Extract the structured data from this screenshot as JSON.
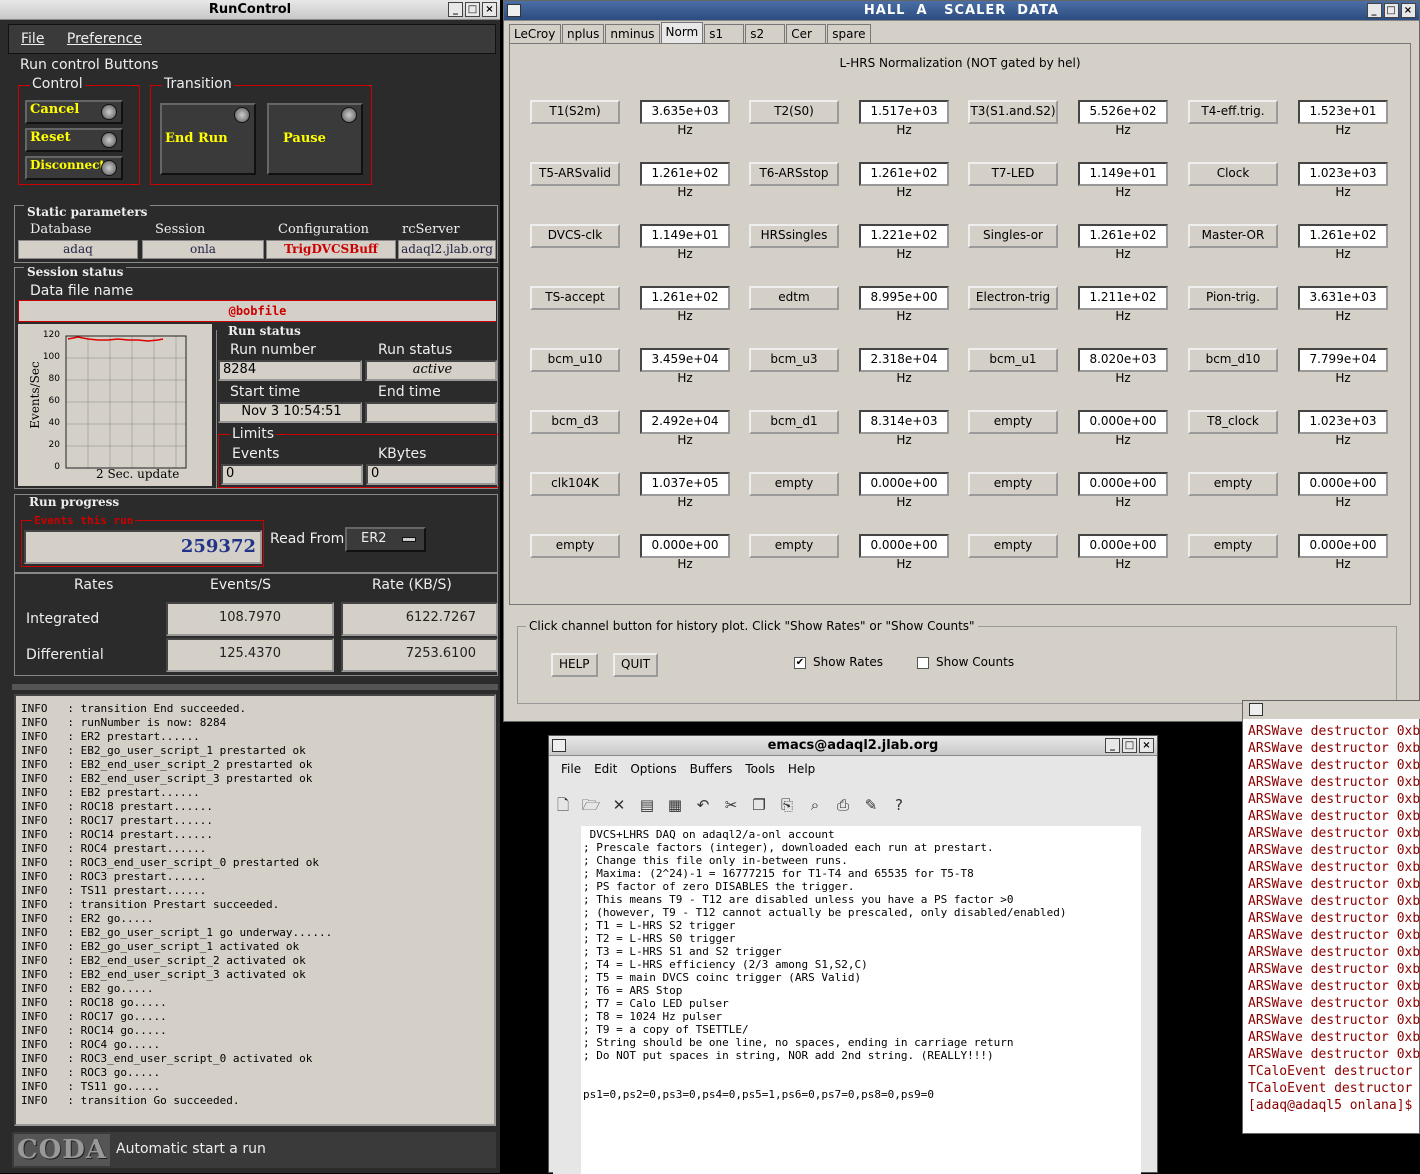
{
  "runcontrol": {
    "title": "RunControl",
    "menu": [
      "File",
      "Preference"
    ],
    "buttons_group": "Run control Buttons",
    "control_label": "Control",
    "cancel": "Cancel",
    "reset": "Reset",
    "disconnect": "Disconnect",
    "transition_label": "Transition",
    "end_run": "End Run",
    "pause": "Pause",
    "static_params": "Static parameters",
    "database_label": "Database",
    "database": "adaq",
    "session_label": "Session",
    "session": "onla",
    "config_label": "Configuration",
    "config": "TrigDVCSBuff",
    "rcserver_label": "rcServer",
    "rcserver": "adaql2.jlab.org",
    "session_status": "Session status",
    "datafile_label": "Data file name",
    "datafile": "@bobfile",
    "chart_ylabel": "Events/Sec",
    "chart_xlabel": "2 Sec. update",
    "chart_ticks": [
      "120",
      "100",
      "80",
      "60",
      "40",
      "20",
      "0"
    ],
    "run_status_title": "Run status",
    "run_number_label": "Run number",
    "run_number": "8284",
    "run_status_label": "Run status",
    "run_status": "active",
    "start_time_label": "Start time",
    "start_time": "Nov 3 10:54:51",
    "end_time_label": "End time",
    "end_time": "",
    "limits_label": "Limits",
    "events_label": "Events",
    "events_limit": "0",
    "kbytes_label": "KBytes",
    "kbytes_limit": "0",
    "run_progress": "Run progress",
    "events_this_run_label": "Events this run",
    "events_this_run": "259372",
    "read_from_label": "Read From:",
    "read_from": "ER2",
    "rates_header": "Rates",
    "events_s_header": "Events/S",
    "rate_kbs_header": "Rate (KB/S)",
    "integrated_label": "Integrated",
    "integrated_events": "108.7970",
    "integrated_rate": "6122.7267",
    "differential_label": "Differential",
    "differential_events": "125.4370",
    "differential_rate": "7253.6100",
    "log": "INFO   : transition End succeeded.\nINFO   : runNumber is now: 8284\nINFO   : ER2 prestart......\nINFO   : EB2_go_user_script_1 prestarted ok\nINFO   : EB2_end_user_script_2 prestarted ok\nINFO   : EB2_end_user_script_3 prestarted ok\nINFO   : EB2 prestart......\nINFO   : ROC18 prestart......\nINFO   : ROC17 prestart......\nINFO   : ROC14 prestart......\nINFO   : ROC4 prestart......\nINFO   : ROC3_end_user_script_0 prestarted ok\nINFO   : ROC3 prestart......\nINFO   : TS11 prestart......\nINFO   : transition Prestart succeeded.\nINFO   : ER2 go.....\nINFO   : EB2_go_user_script_1 go underway......\nINFO   : EB2_go_user_script_1 activated ok\nINFO   : EB2_end_user_script_2 activated ok\nINFO   : EB2_end_user_script_3 activated ok\nINFO   : EB2 go.....\nINFO   : ROC18 go.....\nINFO   : ROC17 go.....\nINFO   : ROC14 go.....\nINFO   : ROC4 go.....\nINFO   : ROC3_end_user_script_0 activated ok\nINFO   : ROC3 go.....\nINFO   : TS11 go.....\nINFO   : transition Go succeeded.",
    "coda_logo": "CODA",
    "status_msg": "Automatic start a run"
  },
  "scaler": {
    "title": "HALL  A   SCALER  DATA",
    "tabs": [
      "LeCroy",
      "nplus",
      "nminus",
      "Norm",
      "s1",
      "s2",
      "Cer",
      "spare"
    ],
    "active_tab": "Norm",
    "panel_title": "L-HRS Normalization (NOT gated by hel)",
    "rows": [
      [
        [
          "T1(S2m)",
          "3.635e+03 Hz"
        ],
        [
          "T2(S0)",
          "1.517e+03 Hz"
        ],
        [
          "T3(S1.and.S2)",
          "5.526e+02 Hz"
        ],
        [
          "T4-eff.trig.",
          "1.523e+01 Hz"
        ]
      ],
      [
        [
          "T5-ARSvalid",
          "1.261e+02 Hz"
        ],
        [
          "T6-ARSstop",
          "1.261e+02 Hz"
        ],
        [
          "T7-LED",
          "1.149e+01 Hz"
        ],
        [
          "Clock",
          "1.023e+03 Hz"
        ]
      ],
      [
        [
          "DVCS-clk",
          "1.149e+01 Hz"
        ],
        [
          "HRSsingles",
          "1.221e+02 Hz"
        ],
        [
          "Singles-or",
          "1.261e+02 Hz"
        ],
        [
          "Master-OR",
          "1.261e+02 Hz"
        ]
      ],
      [
        [
          "TS-accept",
          "1.261e+02 Hz"
        ],
        [
          "edtm",
          "8.995e+00 Hz"
        ],
        [
          "Electron-trig",
          "1.211e+02 Hz"
        ],
        [
          "Pion-trig.",
          "3.631e+03 Hz"
        ]
      ],
      [
        [
          "bcm_u10",
          "3.459e+04 Hz"
        ],
        [
          "bcm_u3",
          "2.318e+04 Hz"
        ],
        [
          "bcm_u1",
          "8.020e+03 Hz"
        ],
        [
          "bcm_d10",
          "7.799e+04 Hz"
        ]
      ],
      [
        [
          "bcm_d3",
          "2.492e+04 Hz"
        ],
        [
          "bcm_d1",
          "8.314e+03 Hz"
        ],
        [
          "empty",
          "0.000e+00 Hz"
        ],
        [
          "T8_clock",
          "1.023e+03 Hz"
        ]
      ],
      [
        [
          "clk104K",
          "1.037e+05 Hz"
        ],
        [
          "empty",
          "0.000e+00 Hz"
        ],
        [
          "empty",
          "0.000e+00 Hz"
        ],
        [
          "empty",
          "0.000e+00 Hz"
        ]
      ],
      [
        [
          "empty",
          "0.000e+00 Hz"
        ],
        [
          "empty",
          "0.000e+00 Hz"
        ],
        [
          "empty",
          "0.000e+00 Hz"
        ],
        [
          "empty",
          "0.000e+00 Hz"
        ]
      ]
    ],
    "hint": "Click channel button for history plot.  Click \"Show Rates\" or \"Show Counts\"",
    "help": "HELP",
    "quit": "QUIT",
    "show_rates": "Show Rates",
    "show_rates_checked": true,
    "show_counts": "Show Counts",
    "show_counts_checked": false
  },
  "emacs": {
    "title": "emacs@adaql2.jlab.org",
    "menu": [
      "File",
      "Edit",
      "Options",
      "Buffers",
      "Tools",
      "Help"
    ],
    "tools": [
      "new-file-icon",
      "open-folder-icon",
      "close-icon",
      "save-icon",
      "save-as-icon",
      "undo-icon",
      "cut-icon",
      "copy-icon",
      "paste-icon",
      "search-icon",
      "print-icon",
      "spell-icon",
      "help-icon"
    ],
    "text": " DVCS+LHRS DAQ on adaql2/a-onl account\n; Prescale factors (integer), downloaded each run at prestart.\n; Change this file only in-between runs.\n; Maxima: (2^24)-1 = 16777215 for T1-T4 and 65535 for T5-T8\n; PS factor of zero DISABLES the trigger.\n; This means T9 - T12 are disabled unless you have a PS factor >0\n; (however, T9 - T12 cannot actually be prescaled, only disabled/enabled)\n; T1 = L-HRS S2 trigger\n; T2 = L-HRS S0 trigger\n; T3 = L-HRS S1 and S2 trigger\n; T4 = L-HRS efficiency (2/3 among S1,S2,C)\n; T5 = main DVCS coinc trigger (ARS Valid)\n; T6 = ARS Stop\n; T7 = Calo LED pulser\n; T8 = 1024 Hz pulser\n; T9 = a copy of TSETTLE/\n; String should be one line, no spaces, ending in carriage return\n; Do NOT put spaces in string, NOR add 2nd string. (REALLY!!!)\n\n\nps1=0,ps2=0,ps3=0,ps4=0,ps5=1,ps6=0,ps7=0,ps8=0,ps9=0"
  },
  "terminal": {
    "text": "ARSWave destructor 0xb\nARSWave destructor 0xb\nARSWave destructor 0xb\nARSWave destructor 0xb\nARSWave destructor 0xb\nARSWave destructor 0xb\nARSWave destructor 0xb\nARSWave destructor 0xb\nARSWave destructor 0xb\nARSWave destructor 0xb\nARSWave destructor 0xb\nARSWave destructor 0xb\nARSWave destructor 0xb\nARSWave destructor 0xb\nARSWave destructor 0xb\nARSWave destructor 0xb\nARSWave destructor 0xb\nARSWave destructor 0xb\nARSWave destructor 0xb\nARSWave destructor 0xb\nTCaloEvent destructor\nTCaloEvent destructor\n[adaq@adaql5 onlana]$"
  },
  "colors": {
    "accent_red": "#cc0000",
    "button_yellow": "#ffff00",
    "coda_bg": "#2b2b2b"
  }
}
